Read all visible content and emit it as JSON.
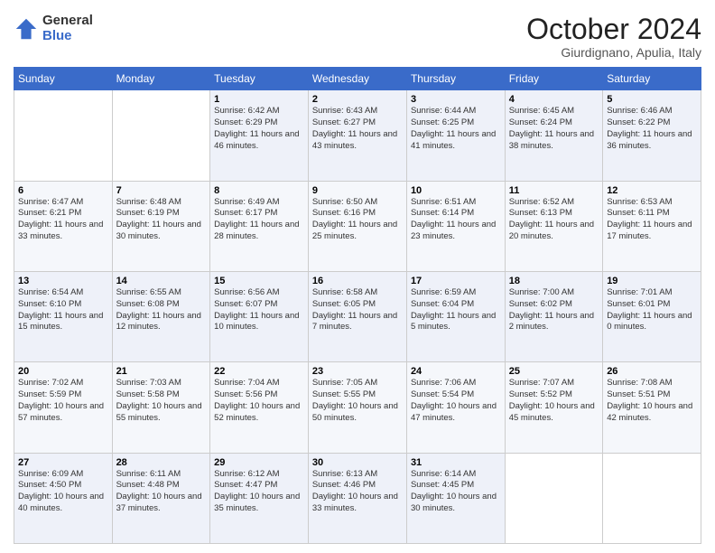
{
  "header": {
    "logo": {
      "general": "General",
      "blue": "Blue"
    },
    "title": "October 2024",
    "location": "Giurdignano, Apulia, Italy"
  },
  "calendar": {
    "days_of_week": [
      "Sunday",
      "Monday",
      "Tuesday",
      "Wednesday",
      "Thursday",
      "Friday",
      "Saturday"
    ],
    "weeks": [
      [
        {
          "num": "",
          "info": ""
        },
        {
          "num": "",
          "info": ""
        },
        {
          "num": "1",
          "info": "Sunrise: 6:42 AM\nSunset: 6:29 PM\nDaylight: 11 hours and 46 minutes."
        },
        {
          "num": "2",
          "info": "Sunrise: 6:43 AM\nSunset: 6:27 PM\nDaylight: 11 hours and 43 minutes."
        },
        {
          "num": "3",
          "info": "Sunrise: 6:44 AM\nSunset: 6:25 PM\nDaylight: 11 hours and 41 minutes."
        },
        {
          "num": "4",
          "info": "Sunrise: 6:45 AM\nSunset: 6:24 PM\nDaylight: 11 hours and 38 minutes."
        },
        {
          "num": "5",
          "info": "Sunrise: 6:46 AM\nSunset: 6:22 PM\nDaylight: 11 hours and 36 minutes."
        }
      ],
      [
        {
          "num": "6",
          "info": "Sunrise: 6:47 AM\nSunset: 6:21 PM\nDaylight: 11 hours and 33 minutes."
        },
        {
          "num": "7",
          "info": "Sunrise: 6:48 AM\nSunset: 6:19 PM\nDaylight: 11 hours and 30 minutes."
        },
        {
          "num": "8",
          "info": "Sunrise: 6:49 AM\nSunset: 6:17 PM\nDaylight: 11 hours and 28 minutes."
        },
        {
          "num": "9",
          "info": "Sunrise: 6:50 AM\nSunset: 6:16 PM\nDaylight: 11 hours and 25 minutes."
        },
        {
          "num": "10",
          "info": "Sunrise: 6:51 AM\nSunset: 6:14 PM\nDaylight: 11 hours and 23 minutes."
        },
        {
          "num": "11",
          "info": "Sunrise: 6:52 AM\nSunset: 6:13 PM\nDaylight: 11 hours and 20 minutes."
        },
        {
          "num": "12",
          "info": "Sunrise: 6:53 AM\nSunset: 6:11 PM\nDaylight: 11 hours and 17 minutes."
        }
      ],
      [
        {
          "num": "13",
          "info": "Sunrise: 6:54 AM\nSunset: 6:10 PM\nDaylight: 11 hours and 15 minutes."
        },
        {
          "num": "14",
          "info": "Sunrise: 6:55 AM\nSunset: 6:08 PM\nDaylight: 11 hours and 12 minutes."
        },
        {
          "num": "15",
          "info": "Sunrise: 6:56 AM\nSunset: 6:07 PM\nDaylight: 11 hours and 10 minutes."
        },
        {
          "num": "16",
          "info": "Sunrise: 6:58 AM\nSunset: 6:05 PM\nDaylight: 11 hours and 7 minutes."
        },
        {
          "num": "17",
          "info": "Sunrise: 6:59 AM\nSunset: 6:04 PM\nDaylight: 11 hours and 5 minutes."
        },
        {
          "num": "18",
          "info": "Sunrise: 7:00 AM\nSunset: 6:02 PM\nDaylight: 11 hours and 2 minutes."
        },
        {
          "num": "19",
          "info": "Sunrise: 7:01 AM\nSunset: 6:01 PM\nDaylight: 11 hours and 0 minutes."
        }
      ],
      [
        {
          "num": "20",
          "info": "Sunrise: 7:02 AM\nSunset: 5:59 PM\nDaylight: 10 hours and 57 minutes."
        },
        {
          "num": "21",
          "info": "Sunrise: 7:03 AM\nSunset: 5:58 PM\nDaylight: 10 hours and 55 minutes."
        },
        {
          "num": "22",
          "info": "Sunrise: 7:04 AM\nSunset: 5:56 PM\nDaylight: 10 hours and 52 minutes."
        },
        {
          "num": "23",
          "info": "Sunrise: 7:05 AM\nSunset: 5:55 PM\nDaylight: 10 hours and 50 minutes."
        },
        {
          "num": "24",
          "info": "Sunrise: 7:06 AM\nSunset: 5:54 PM\nDaylight: 10 hours and 47 minutes."
        },
        {
          "num": "25",
          "info": "Sunrise: 7:07 AM\nSunset: 5:52 PM\nDaylight: 10 hours and 45 minutes."
        },
        {
          "num": "26",
          "info": "Sunrise: 7:08 AM\nSunset: 5:51 PM\nDaylight: 10 hours and 42 minutes."
        }
      ],
      [
        {
          "num": "27",
          "info": "Sunrise: 6:09 AM\nSunset: 4:50 PM\nDaylight: 10 hours and 40 minutes."
        },
        {
          "num": "28",
          "info": "Sunrise: 6:11 AM\nSunset: 4:48 PM\nDaylight: 10 hours and 37 minutes."
        },
        {
          "num": "29",
          "info": "Sunrise: 6:12 AM\nSunset: 4:47 PM\nDaylight: 10 hours and 35 minutes."
        },
        {
          "num": "30",
          "info": "Sunrise: 6:13 AM\nSunset: 4:46 PM\nDaylight: 10 hours and 33 minutes."
        },
        {
          "num": "31",
          "info": "Sunrise: 6:14 AM\nSunset: 4:45 PM\nDaylight: 10 hours and 30 minutes."
        },
        {
          "num": "",
          "info": ""
        },
        {
          "num": "",
          "info": ""
        }
      ]
    ]
  }
}
